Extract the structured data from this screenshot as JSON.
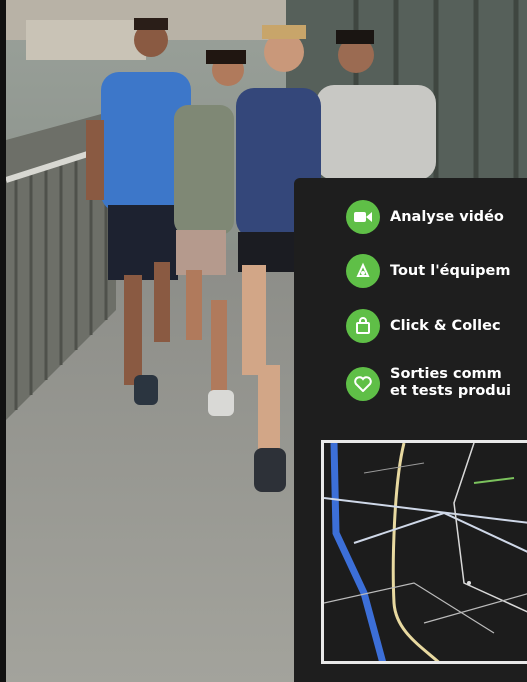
{
  "features": [
    {
      "label": "Analyse vidéo",
      "icon": "video-camera-icon"
    },
    {
      "label": "Tout l'équipem",
      "icon": "equipment-icon"
    },
    {
      "label": "Click & Collec",
      "icon": "shopping-bag-icon"
    },
    {
      "label_line1": "Sorties comm",
      "label_line2": "et tests produi",
      "icon": "heart-icon"
    }
  ],
  "colors": {
    "accent": "#5fbf47",
    "panel": "#1e1e1e",
    "map_bg": "#1c1c1c"
  }
}
